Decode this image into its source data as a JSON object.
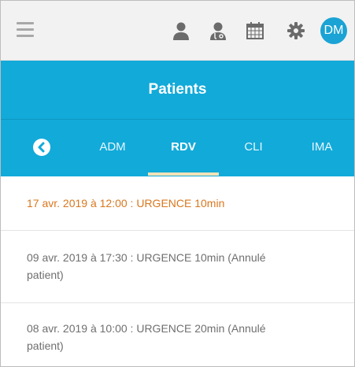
{
  "topbar": {
    "menu_icon": "hamburger-menu-icon",
    "icons": [
      "user-icon",
      "doctor-icon",
      "calendar-icon",
      "settings-gear-icon"
    ],
    "avatar_initials": "DM"
  },
  "header": {
    "title": "Patients"
  },
  "tabs": {
    "back_icon": "chevron-left-circle-icon",
    "items": [
      {
        "label": "ADM",
        "active": false
      },
      {
        "label": "RDV",
        "active": true
      },
      {
        "label": "CLI",
        "active": false
      },
      {
        "label": "IMA",
        "active": false
      }
    ]
  },
  "appointments": [
    {
      "text": "17 avr. 2019 à 12:00 : URGENCE 10min",
      "highlight": true
    },
    {
      "text": "09 avr. 2019 à 17:30 : URGENCE 10min (Annulé patient)",
      "highlight": false
    },
    {
      "text": "08 avr. 2019 à 10:00 : URGENCE 20min (Annulé patient)",
      "highlight": false
    }
  ],
  "colors": {
    "primary": "#12aad9",
    "avatar": "#1aa3d4",
    "highlight_text": "#d9771e",
    "tab_underline": "#f3e2b8"
  }
}
